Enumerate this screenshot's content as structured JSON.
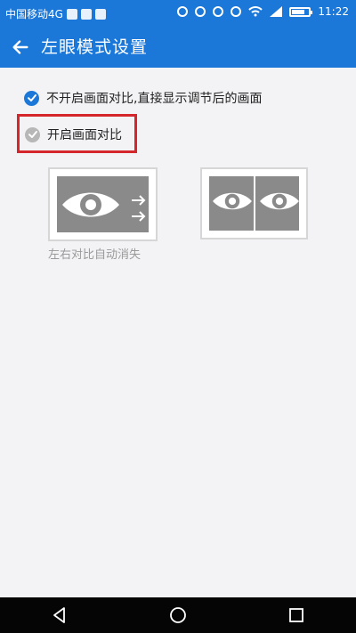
{
  "status_bar": {
    "carrier": "中国移动4G",
    "network": "4G",
    "time": "11:22"
  },
  "app_bar": {
    "title": "左眼模式设置"
  },
  "options": [
    {
      "label": "不开启画面对比,直接显示调节后的画面",
      "checked": true
    },
    {
      "label": "开启画面对比",
      "checked": false
    }
  ],
  "preview": {
    "caption": "左右对比自动消失"
  },
  "icons": [
    "back-arrow-icon",
    "check-icon",
    "eye-icon",
    "arrow-right-icon",
    "nav-back-icon",
    "nav-home-icon",
    "nav-recent-icon"
  ],
  "colors": {
    "accent": "#1b78d9",
    "highlight": "#d4262b"
  }
}
